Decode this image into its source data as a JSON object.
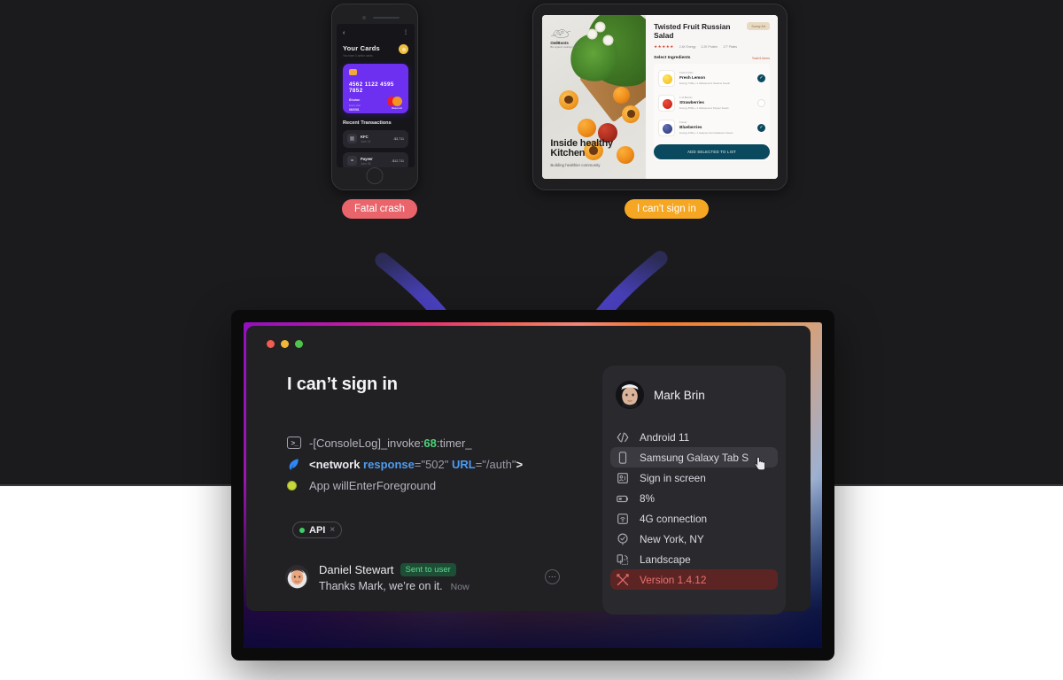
{
  "background": {
    "dark": "#1b1b1d",
    "light": "#ffffff"
  },
  "mockups": {
    "phone": {
      "back_icon": "chevron-left-icon",
      "menu_icon": "more-vertical-icon",
      "title": "Your Cards",
      "subtitle": "You have 2 active cards",
      "card": {
        "number": "4562 1122 4595 7852",
        "holder": "Bhutan",
        "expiry_label": "Expiry date",
        "expiry_value": "06/2081",
        "brand": "Mastercard"
      },
      "transactions_title": "Recent Transactions",
      "transactions": [
        {
          "name": "KFC",
          "date": "June 24",
          "amount": "-$3,711"
        },
        {
          "name": "Payeer",
          "date": "June 28",
          "amount": "-$12,711"
        }
      ]
    },
    "tablet": {
      "brand_name": "OwlBoots",
      "brand_desc": "Bio organic cooking nutrition",
      "hero_heading": "Inside healthy Kitchen",
      "hero_sub": "Building healthier community",
      "title": "Twisted Fruit Russian Salad",
      "badge": "Sunny Art",
      "stars": "★★★★★",
      "meta": [
        "2.4K Energy",
        "3.2K Protein",
        "177 Plates"
      ],
      "section_title": "Select Ingredients",
      "section_action": "Total 6 items",
      "ingredients": [
        {
          "category": "Fruit & Citric",
          "name": "Fresh Lemon",
          "desc": "Energy 740kj + 2 tablespoons Sesame Seeds",
          "selected": true
        },
        {
          "category": "Li & Berries",
          "name": "Strawberries",
          "desc": "Energy 560kj + 2 tablespoons Pepper Seeds",
          "selected": false
        },
        {
          "category": "Forest",
          "name": "Blueberries",
          "desc": "Energy 440kj + 1 teaspoon Hot Habanero Sauce",
          "selected": true
        }
      ],
      "cta": "ADD SELECTED TO LIST"
    }
  },
  "labels": {
    "fatal_crash": "Fatal crash",
    "cant_sign_in": "I can't sign in",
    "crash_color": "#e9656b",
    "signin_color": "#f5a623"
  },
  "window": {
    "traffic_lights": [
      "close-red",
      "minimize-yellow",
      "maximize-green"
    ],
    "title": "I can’t sign in",
    "logs": [
      {
        "icon": "terminal-icon",
        "glyph": ">_",
        "prefix": "-[ConsoleLog]_invoke:",
        "number": "68",
        "suffix": ":timer_"
      },
      {
        "icon": "network-leaf-icon",
        "tag_open": "<network ",
        "key1": "response",
        "val1": "=\"502\" ",
        "key2": "URL",
        "val2": "=\"/auth\"",
        "tag_close": ">"
      },
      {
        "icon": "status-dot-icon",
        "text": "App willEnterForeground"
      }
    ],
    "tag": {
      "label": "API",
      "dot_color": "#3fcf62",
      "close": "×"
    },
    "comment": {
      "author": "Daniel Stewart",
      "badge": "Sent to user",
      "text": "Thanks Mark, we’re on it.",
      "time": "Now",
      "more_icon": "ellipsis-icon"
    }
  },
  "panel": {
    "user": {
      "name": "Mark Brin",
      "avatar": "user-avatar"
    },
    "items": [
      {
        "icon": "code-brackets-icon",
        "label": "Android 11",
        "state": "normal"
      },
      {
        "icon": "phone-icon",
        "label": "Samsung Galaxy Tab S",
        "state": "hover"
      },
      {
        "icon": "sign-in-screen-icon",
        "label": "Sign in screen",
        "state": "normal"
      },
      {
        "icon": "battery-icon",
        "label": "8%",
        "state": "normal"
      },
      {
        "icon": "signal-icon",
        "label": "4G connection",
        "state": "normal"
      },
      {
        "icon": "location-pin-icon",
        "label": "New York, NY",
        "state": "normal"
      },
      {
        "icon": "orientation-landscape-icon",
        "label": "Landscape",
        "state": "normal"
      },
      {
        "icon": "wrench-tools-icon",
        "label": "Version 1.4.12",
        "state": "warning"
      }
    ],
    "cursor": "pointer-hand-cursor"
  }
}
